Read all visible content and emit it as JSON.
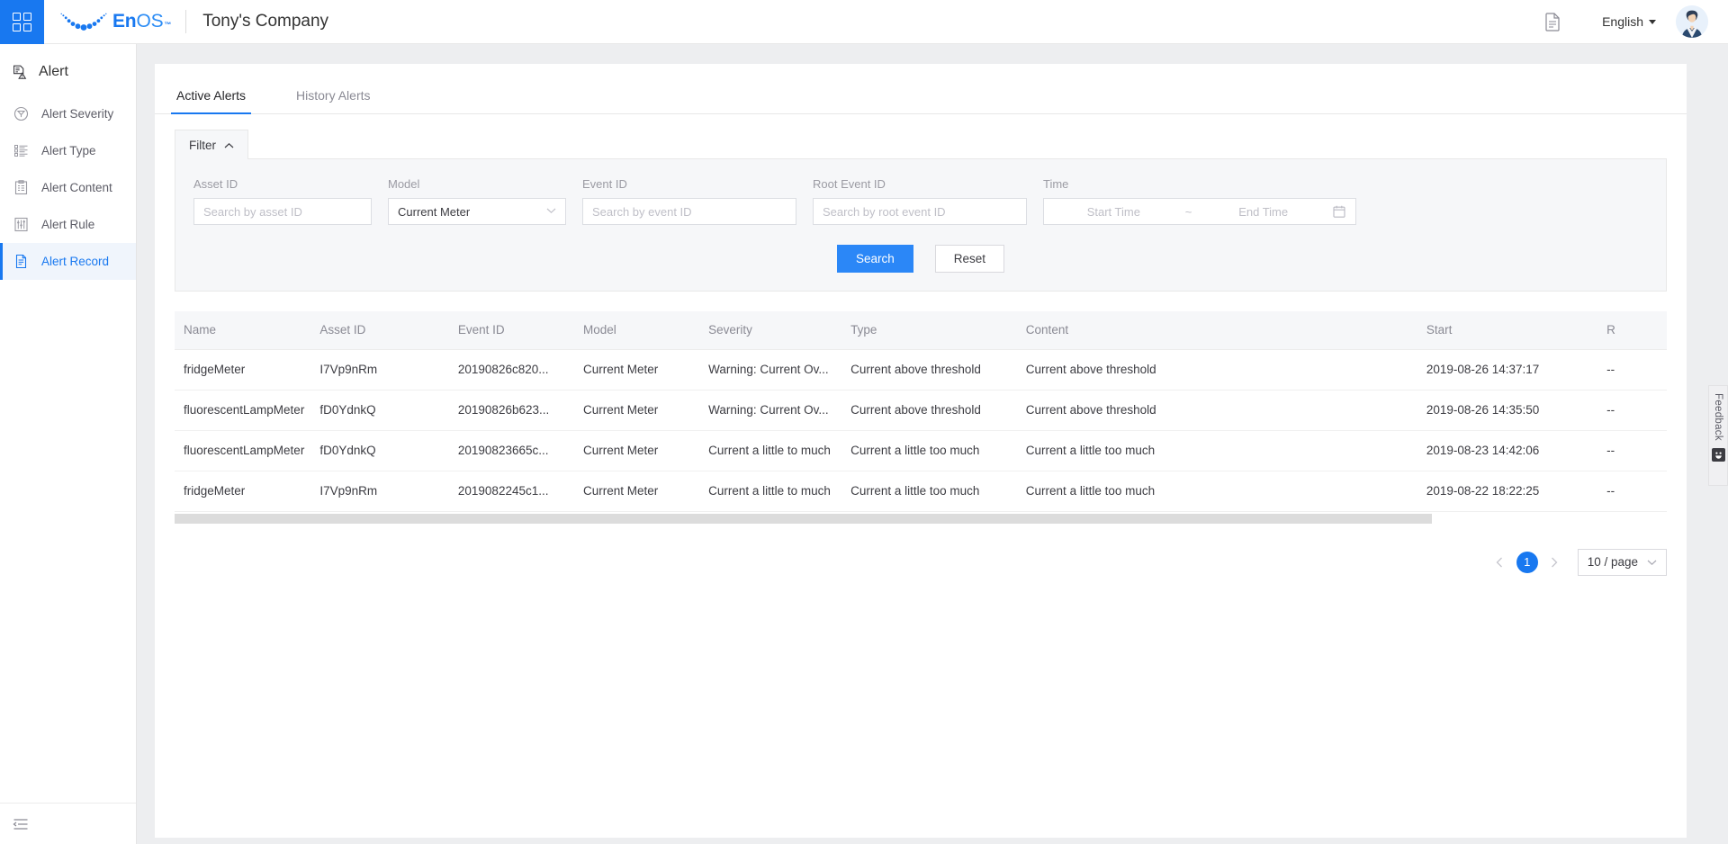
{
  "header": {
    "app_launcher_icon": "grid-icon",
    "brand": {
      "en": "En",
      "os": "OS",
      "tm": "™"
    },
    "company": "Tony's Company",
    "doc_icon": "document-icon",
    "language": "English",
    "avatar_icon": "user-avatar"
  },
  "sidebar": {
    "title": "Alert",
    "title_icon": "alert-document-icon",
    "items": [
      {
        "label": "Alert Severity",
        "icon": "severity-icon",
        "active": false
      },
      {
        "label": "Alert Type",
        "icon": "list-icon",
        "active": false
      },
      {
        "label": "Alert Content",
        "icon": "clipboard-icon",
        "active": false
      },
      {
        "label": "Alert Rule",
        "icon": "sliders-icon",
        "active": false
      },
      {
        "label": "Alert Record",
        "icon": "file-icon",
        "active": true
      }
    ],
    "collapse_icon": "collapse-sidebar-icon"
  },
  "tabs": [
    {
      "label": "Active Alerts",
      "active": true
    },
    {
      "label": "History Alerts",
      "active": false
    }
  ],
  "filter": {
    "tab_label": "Filter",
    "collapse_icon": "chevron-up-icon",
    "fields": {
      "asset_id": {
        "label": "Asset ID",
        "placeholder": "Search by asset ID",
        "value": ""
      },
      "model": {
        "label": "Model",
        "value": "Current Meter"
      },
      "event_id": {
        "label": "Event ID",
        "placeholder": "Search by event ID",
        "value": ""
      },
      "root_event_id": {
        "label": "Root Event ID",
        "placeholder": "Search by root event ID",
        "value": ""
      },
      "time": {
        "label": "Time",
        "start_placeholder": "Start Time",
        "separator": "~",
        "end_placeholder": "End Time",
        "icon": "calendar-icon"
      }
    },
    "search_label": "Search",
    "reset_label": "Reset"
  },
  "table": {
    "columns": [
      "Name",
      "Asset ID",
      "Event ID",
      "Model",
      "Severity",
      "Type",
      "Content",
      "Start",
      "R"
    ],
    "rows": [
      {
        "name": "fridgeMeter",
        "asset_id": "I7Vp9nRm",
        "event_id": "20190826c820...",
        "model": "Current Meter",
        "severity": "Warning: Current Ov...",
        "type": "Current above threshold",
        "content": "Current above threshold",
        "start": "2019-08-26 14:37:17",
        "r": "--"
      },
      {
        "name": "fluorescentLampMeter",
        "asset_id": "fD0YdnkQ",
        "event_id": "20190826b623...",
        "model": "Current Meter",
        "severity": "Warning: Current Ov...",
        "type": "Current above threshold",
        "content": "Current above threshold",
        "start": "2019-08-26 14:35:50",
        "r": "--"
      },
      {
        "name": "fluorescentLampMeter",
        "asset_id": "fD0YdnkQ",
        "event_id": "20190823665c...",
        "model": "Current Meter",
        "severity": "Current a little to much",
        "type": "Current a little too much",
        "content": "Current a little too much",
        "start": "2019-08-23 14:42:06",
        "r": "--"
      },
      {
        "name": "fridgeMeter",
        "asset_id": "I7Vp9nRm",
        "event_id": "2019082245c1...",
        "model": "Current Meter",
        "severity": "Current a little to much",
        "type": "Current a little too much",
        "content": "Current a little too much",
        "start": "2019-08-22 18:22:25",
        "r": "--"
      }
    ]
  },
  "pagination": {
    "prev_icon": "chevron-left-icon",
    "current_page": "1",
    "next_icon": "chevron-right-icon",
    "page_size": "10 / page",
    "page_size_icon": "chevron-down-icon"
  },
  "feedback": {
    "label": "Feedback",
    "icon": "smiley-icon"
  },
  "colors": {
    "accent": "#1878f0",
    "primary_button": "#2b87f7",
    "panel_bg": "#f6f7f9",
    "page_bg": "#edeef0"
  }
}
